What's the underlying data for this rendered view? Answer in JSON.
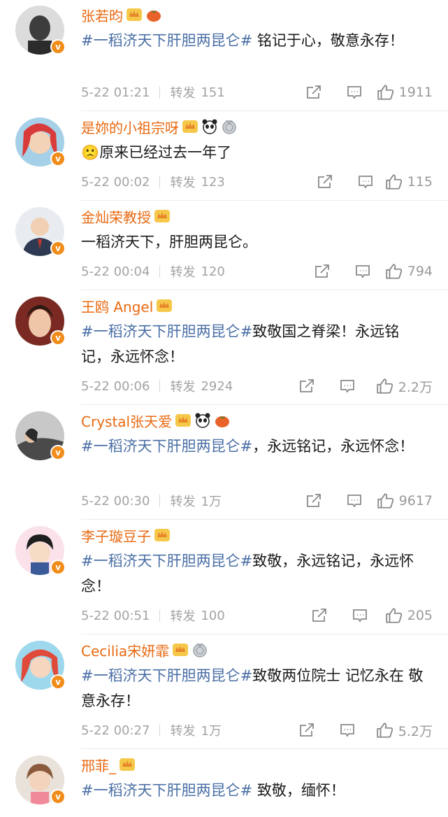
{
  "colors": {
    "name": "#e86a12",
    "topic": "#4a6fa5",
    "meta": "#a3a3a3",
    "verified": "#f08c1a"
  },
  "labels": {
    "repost": "转发"
  },
  "comments": [
    {
      "name": "张若昀",
      "badges": [
        "crown-icon",
        "persimmon-icon"
      ],
      "topic": "#一稻济天下肝胆两昆仑#",
      "text": " 铭记于心，敬意永存！",
      "time": "5-22 01:21",
      "reposts": "151",
      "likes": "1911",
      "avatar_color": "#3d3d3d"
    },
    {
      "name": "是妳的小祖宗呀",
      "badges": [
        "crown-icon",
        "panda-icon",
        "medal-icon"
      ],
      "topic": "",
      "text": "🙁原来已经过去一年了",
      "time": "5-22 00:02",
      "reposts": "123",
      "likes": "115",
      "avatar_color": "#d93a3a"
    },
    {
      "name": "金灿荣教授",
      "badges": [
        "crown-icon"
      ],
      "topic": "",
      "text": "一稻济天下，肝胆两昆仑。",
      "time": "5-22 00:04",
      "reposts": "120",
      "likes": "794",
      "avatar_color": "#4a5a78"
    },
    {
      "name": "王鸥 Angel",
      "badges": [
        "crown-icon"
      ],
      "topic": "#一稻济天下肝胆两昆仑#",
      "text": "致敬国之脊梁！永远铭记，永远怀念！",
      "time": "5-22 00:06",
      "reposts": "2924",
      "likes": "2.2万",
      "avatar_color": "#a0423a"
    },
    {
      "name": "Crystal张天爱",
      "badges": [
        "crown-icon",
        "panda-icon",
        "persimmon-icon"
      ],
      "topic": "#一稻济天下肝胆两昆仑#",
      "text": "，永远铭记，永远怀念！",
      "time": "5-22 00:30",
      "reposts": "1万",
      "likes": "9617",
      "avatar_color": "#6a6a6a"
    },
    {
      "name": "李子璇豆子",
      "badges": [
        "crown-icon"
      ],
      "topic": "#一稻济天下肝胆两昆仑#",
      "text": "致敬，永远铭记，永远怀念！",
      "time": "5-22 00:51",
      "reposts": "100",
      "likes": "205",
      "avatar_color": "#f2b8c6"
    },
    {
      "name": "Cecilia宋妍霏",
      "badges": [
        "crown-icon",
        "medal-icon"
      ],
      "topic": "#一稻济天下肝胆两昆仑#",
      "text": "致敬两位院士 记忆永在 敬意永存！",
      "time": "5-22 00:27",
      "reposts": "1万",
      "likes": "5.2万",
      "avatar_color": "#e04a3a"
    },
    {
      "name": "邢菲_",
      "badges": [
        "crown-icon"
      ],
      "topic": "#一稻济天下肝胆两昆仑#",
      "text": " 致敬，缅怀！",
      "time": "",
      "reposts": "",
      "likes": "",
      "avatar_color": "#c9a27a"
    }
  ]
}
